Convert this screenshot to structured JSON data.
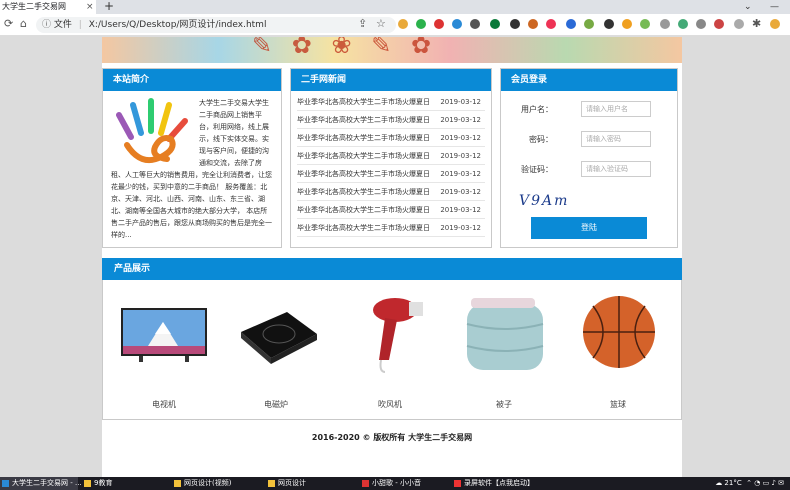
{
  "browser": {
    "tab_title": "大学生二手交易网",
    "tab_close": "×",
    "new_tab": "+",
    "win_min": "—",
    "win_chevron": "⌄",
    "address_info": "文件",
    "address_url": "X:/Users/Q/Desktop/网页设计/index.html"
  },
  "intro": {
    "title": "本站简介",
    "text": "大学生二手交易大学生二手商品网上销售平台，利用网络，线上展示，线下实体交易。实现与客户间，便捷的沟通和交流，去除了房租、人工等巨大的销售费用，完全让利消费者，让您花最少的钱，买到中意的二手商品！ 服务覆盖：北京、天津、河北、山西、河南、山东、东三省、湖北、湖南等全国各大城市的绝大部分大学， 本店所售二手产品的售后，跟您从商场购买的售后是完全一样的..."
  },
  "news": {
    "title": "二手网新闻",
    "items": [
      {
        "title": "毕业季华北各高校大学生二手市场火爆夏日",
        "date": "2019-03-12"
      },
      {
        "title": "毕业季华北各高校大学生二手市场火爆夏日",
        "date": "2019-03-12"
      },
      {
        "title": "毕业季华北各高校大学生二手市场火爆夏日",
        "date": "2019-03-12"
      },
      {
        "title": "毕业季华北各高校大学生二手市场火爆夏日",
        "date": "2019-03-12"
      },
      {
        "title": "毕业季华北各高校大学生二手市场火爆夏日",
        "date": "2019-03-12"
      },
      {
        "title": "毕业季华北各高校大学生二手市场火爆夏日",
        "date": "2019-03-12"
      },
      {
        "title": "毕业季华北各高校大学生二手市场火爆夏日",
        "date": "2019-03-12"
      },
      {
        "title": "毕业季华北各高校大学生二手市场火爆夏日",
        "date": "2019-03-12"
      }
    ]
  },
  "login": {
    "title": "会员登录",
    "username_label": "用户名：",
    "username_placeholder": "请输入用户名",
    "password_label": "密码：",
    "password_placeholder": "请输入密码",
    "captcha_label": "验证码：",
    "captcha_placeholder": "请输入验证码",
    "captcha_text": "V9Am",
    "submit": "登陆"
  },
  "products": {
    "title": "产品展示",
    "items": [
      {
        "label": "电视机",
        "icon": "tv-icon"
      },
      {
        "label": "电磁炉",
        "icon": "cooktop-icon"
      },
      {
        "label": "吹风机",
        "icon": "hairdryer-icon"
      },
      {
        "label": "被子",
        "icon": "quilt-icon"
      },
      {
        "label": "篮球",
        "icon": "basketball-icon"
      }
    ]
  },
  "footer": {
    "text": "2016-2020 © 版权所有 大学生二手交易网"
  },
  "taskbar": {
    "items": [
      "大学生二手交易网 - ...",
      "9教育",
      "网页设计(视频)",
      "网页设计",
      "小甜歌 - 小小音",
      "录屏软件【点我启动】"
    ],
    "weather": "21°C",
    "colors": {
      "accent": "#0a8ad6"
    }
  }
}
